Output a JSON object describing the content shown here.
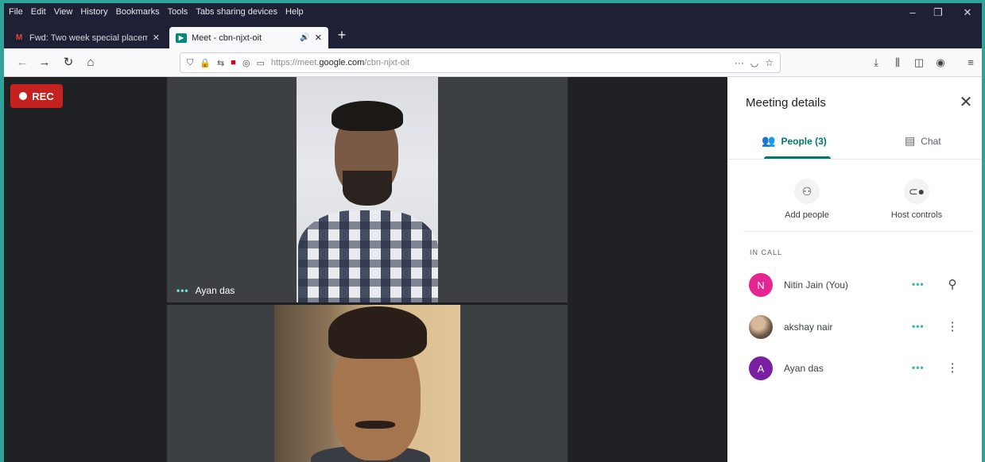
{
  "browser": {
    "menu": [
      "File",
      "Edit",
      "View",
      "History",
      "Bookmarks",
      "Tools",
      "Tabs sharing devices",
      "Help"
    ],
    "window_controls": {
      "minimize": "–",
      "restore": "❐",
      "close": "✕"
    },
    "tabs": [
      {
        "title": "Fwd: Two week special placem",
        "favicon": "gmail-icon",
        "favicon_glyph": "M",
        "close": "✕"
      },
      {
        "title": "Meet - cbn-njxt-oit",
        "favicon": "meet-icon",
        "favicon_glyph": "▶",
        "audio": "🔊",
        "close": "✕"
      }
    ],
    "new_tab": "+",
    "url_prefix": "https://meet.",
    "url_domain": "google.com",
    "url_path": "/cbn-njxt-oit",
    "page_actions": "···"
  },
  "meeting": {
    "rec_label": "REC",
    "tiles": [
      {
        "name": "Ayan das",
        "indicator": "•••"
      },
      {
        "name": ""
      }
    ]
  },
  "panel": {
    "title": "Meeting details",
    "close": "✕",
    "tabs": {
      "people": "People (3)",
      "chat": "Chat"
    },
    "actions": {
      "add_people": "Add people",
      "host_controls": "Host controls"
    },
    "section": "IN CALL",
    "participants": [
      {
        "name": "Nitin Jain (You)",
        "initial": "N",
        "color": "#e52592",
        "more": "•••",
        "action_icon": "pin-icon",
        "action_glyph": "⚲"
      },
      {
        "name": "akshay nair",
        "initial": "",
        "color": "#8a7a6a",
        "more": "•••",
        "action_icon": "more-vert-icon",
        "action_glyph": "⋮"
      },
      {
        "name": "Ayan das",
        "initial": "A",
        "color": "#7b1fa2",
        "more": "•••",
        "action_icon": "more-vert-icon",
        "action_glyph": "⋮"
      }
    ]
  },
  "colors": {
    "accent": "#00796b",
    "rec": "#c5221f",
    "frame": "#2fa39a"
  }
}
